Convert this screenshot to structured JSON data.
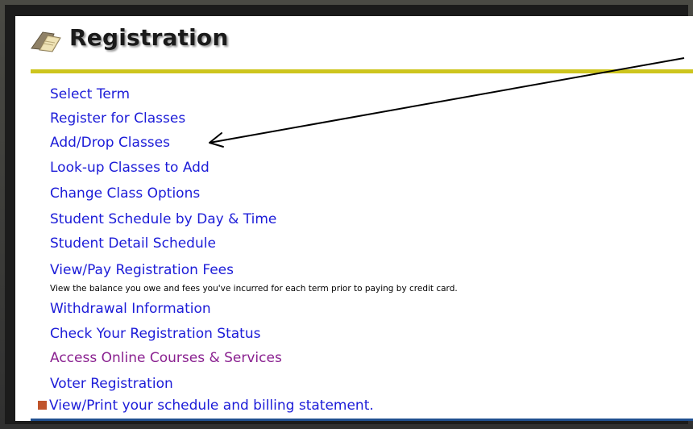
{
  "header": {
    "title": "Registration",
    "icon": "folder-icon"
  },
  "menu": {
    "items": [
      {
        "label": "Select Term",
        "visited": false
      },
      {
        "label": "Register for Classes",
        "visited": false
      },
      {
        "label": "Add/Drop Classes",
        "visited": false
      },
      {
        "label": "Look-up Classes to Add",
        "visited": false
      },
      {
        "label": "Change Class Options",
        "visited": false
      },
      {
        "label": "Student Schedule by Day & Time",
        "visited": false
      },
      {
        "label": "Student Detail Schedule",
        "visited": false
      },
      {
        "label": "View/Pay Registration Fees",
        "visited": false
      },
      {
        "label": "Withdrawal Information",
        "visited": false
      },
      {
        "label": "Check Your Registration Status",
        "visited": false
      },
      {
        "label": "Access Online Courses & Services",
        "visited": true
      },
      {
        "label": "Voter Registration",
        "visited": false
      }
    ],
    "fees_description": "View the balance you owe and fees you've incurred for each term prior to paying by credit card.",
    "schedule_link": "View/Print your schedule and billing statement."
  },
  "annotation": {
    "type": "arrow",
    "points_to": "Add/Drop Classes"
  },
  "colors": {
    "link": "#1c1cd8",
    "visited_link": "#8a2190",
    "accent_rule": "#cdc51e",
    "bottom_rule": "#1f4f8f",
    "bullet": "#c0542b",
    "frame": "#3b3b36"
  }
}
